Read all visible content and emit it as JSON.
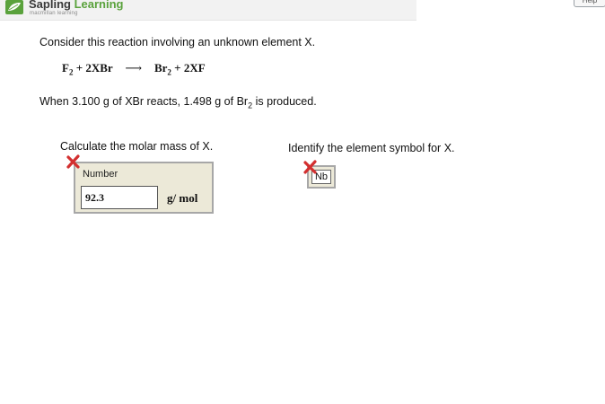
{
  "header": {
    "brand_part1": "Sapling",
    "brand_part2": "Learning",
    "sub_brand": "macmillan learning",
    "help_label": "Help"
  },
  "problem": {
    "intro": "Consider this reaction involving an unknown element X.",
    "equation": {
      "left1": "F",
      "left1_sub": "2",
      "left_plus": " + 2XBr",
      "arrow": "⟶",
      "right1": "Br",
      "right1_sub": "2",
      "right_plus": " + 2XF"
    },
    "given_part1": "When 3.100 g of XBr reacts, 1.498 g of Br",
    "given_sub": "2",
    "given_part2": " is produced."
  },
  "question1": {
    "prompt": "Calculate the molar mass of X.",
    "field_label": "Number",
    "value": "92.3",
    "unit": "g/ mol",
    "status": "incorrect"
  },
  "question2": {
    "prompt": "Identify the element symbol for X.",
    "value": "Nb",
    "status": "incorrect"
  },
  "colors": {
    "brand_green": "#5aa23c",
    "answer_panel": "#ece9d8",
    "error_red": "#d32f2f"
  },
  "icons": {
    "logo": "sapling-leaf-icon",
    "incorrect": "red-x-icon"
  }
}
